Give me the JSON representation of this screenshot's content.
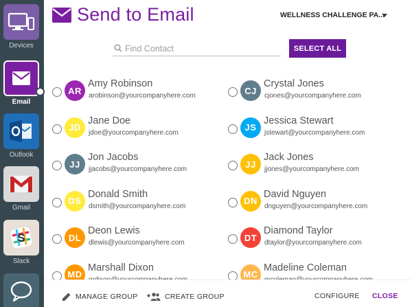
{
  "sidebar": {
    "items": [
      {
        "label": "Devices",
        "icon": "devices-icon",
        "color": "#7b5ea7"
      },
      {
        "label": "Email",
        "icon": "email-icon",
        "color": "#7b1fa2",
        "active": true
      },
      {
        "label": "Outlook",
        "icon": "outlook-icon",
        "color": "#1e6fb8"
      },
      {
        "label": "Gmail",
        "icon": "gmail-icon",
        "color": "#d9d9d9"
      },
      {
        "label": "Slack",
        "icon": "slack-icon",
        "color": "#e8e0d8"
      },
      {
        "label": "",
        "icon": "chat-icon",
        "color": "#4a6572"
      }
    ]
  },
  "header": {
    "title": "Send to Email",
    "challenge": "WELLNESS CHALLENGE PA..."
  },
  "search": {
    "placeholder": "Find Contact",
    "value": ""
  },
  "select_all_label": "SELECT ALL",
  "contacts": [
    {
      "initials": "AR",
      "name": "Amy Robinson",
      "email": "arobinson@yourcompanyhere.com",
      "color": "#9c27b0"
    },
    {
      "initials": "CJ",
      "name": "Crystal Jones",
      "email": "cjones@yourcompanyhere.com",
      "color": "#607d8b"
    },
    {
      "initials": "JD",
      "name": "Jane Doe",
      "email": "jdoe@yourcompanyhere.com",
      "color": "#ffeb3b"
    },
    {
      "initials": "JS",
      "name": "Jessica Stewart",
      "email": "jstewart@yourcompanyhere.com",
      "color": "#03a9f4"
    },
    {
      "initials": "JJ",
      "name": "Jon Jacobs",
      "email": "jjacobs@yourcompanyhere.com",
      "color": "#607d8b"
    },
    {
      "initials": "JJ",
      "name": "Jack Jones",
      "email": "jjones@yourcompanyhere.com",
      "color": "#ffc107"
    },
    {
      "initials": "DS",
      "name": "Donald Smith",
      "email": "dsmith@yourcompanyhere.com",
      "color": "#ffeb3b"
    },
    {
      "initials": "DN",
      "name": "David Nguyen",
      "email": "dnguyen@yourcompanyhere.com",
      "color": "#ffc107"
    },
    {
      "initials": "DL",
      "name": "Deon Lewis",
      "email": "dlewis@yourcompanyhere.com",
      "color": "#ff9800"
    },
    {
      "initials": "DT",
      "name": "Diamond Taylor",
      "email": "dtaylor@yourcompanyhere.com",
      "color": "#f44336"
    },
    {
      "initials": "MD",
      "name": "Marshall Dixon",
      "email": "mdixon@yourcompanyhere.com",
      "color": "#ff9800"
    },
    {
      "initials": "MC",
      "name": "Madeline Coleman",
      "email": "mcoleman@yourcompanyhere.com",
      "color": "#ffb74d"
    }
  ],
  "footer": {
    "manage_group": "MANAGE GROUP",
    "create_group": "CREATE GROUP",
    "configure": "CONFIGURE",
    "close": "CLOSE"
  },
  "colors": {
    "accent": "#7b1fa2",
    "sidebar_bg": "#37474f",
    "button": "#6a1b9a"
  }
}
